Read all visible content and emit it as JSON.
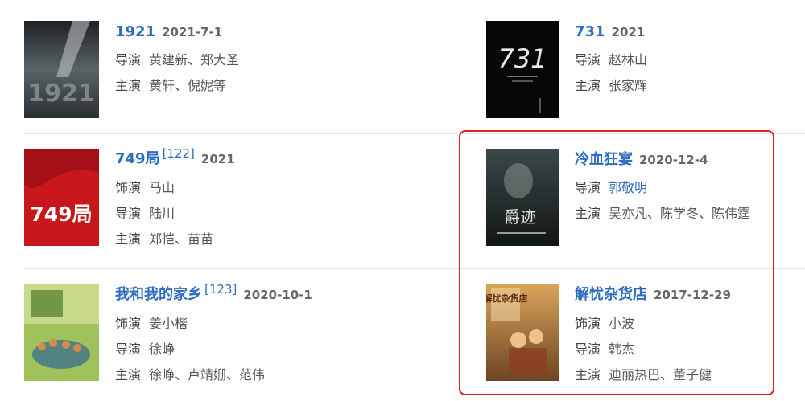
{
  "colors": {
    "link": "#2d6cc0",
    "highlight": "#e2231a",
    "divider": "#e6e6e6"
  },
  "films": {
    "f1921": {
      "title": "1921",
      "date": "2021-7-1",
      "poster_text": "1921",
      "rows": [
        {
          "role": "导演",
          "people": "黄建新、郑大圣"
        },
        {
          "role": "主演",
          "people": "黄轩、倪妮等"
        }
      ]
    },
    "f731": {
      "title": "731",
      "date": "2021",
      "poster_text": "731",
      "rows": [
        {
          "role": "导演",
          "people": "赵林山"
        },
        {
          "role": "主演",
          "people": "张家辉"
        }
      ]
    },
    "f749": {
      "title": "749局",
      "ref": "[122]",
      "date": "2021",
      "poster_text": "749局",
      "rows": [
        {
          "role": "饰演",
          "people": "马山"
        },
        {
          "role": "导演",
          "people": "陆川"
        },
        {
          "role": "主演",
          "people": "郑恺、苗苗"
        }
      ]
    },
    "fblood": {
      "title": "冷血狂宴",
      "date": "2020-12-4",
      "poster_text": "爵迹",
      "rows": [
        {
          "role": "导演",
          "people": "郭敬明"
        },
        {
          "role": "主演",
          "people": "吴亦凡、陈学冬、陈伟霆"
        }
      ]
    },
    "fhome": {
      "title": "我和我的家乡",
      "ref": "[123]",
      "date": "2020-10-1",
      "rows": [
        {
          "role": "饰演",
          "people": "姜小楷"
        },
        {
          "role": "导演",
          "people": "徐峥"
        },
        {
          "role": "主演",
          "people": "徐峥、卢靖姗、范伟"
        }
      ]
    },
    "fstore": {
      "title": "解忧杂货店",
      "date": "2017-12-29",
      "poster_text": "解忧杂货店",
      "rows": [
        {
          "role": "饰演",
          "people": "小波"
        },
        {
          "role": "导演",
          "people": "韩杰"
        },
        {
          "role": "主演",
          "people": "迪丽热巴、董子健"
        }
      ]
    }
  }
}
